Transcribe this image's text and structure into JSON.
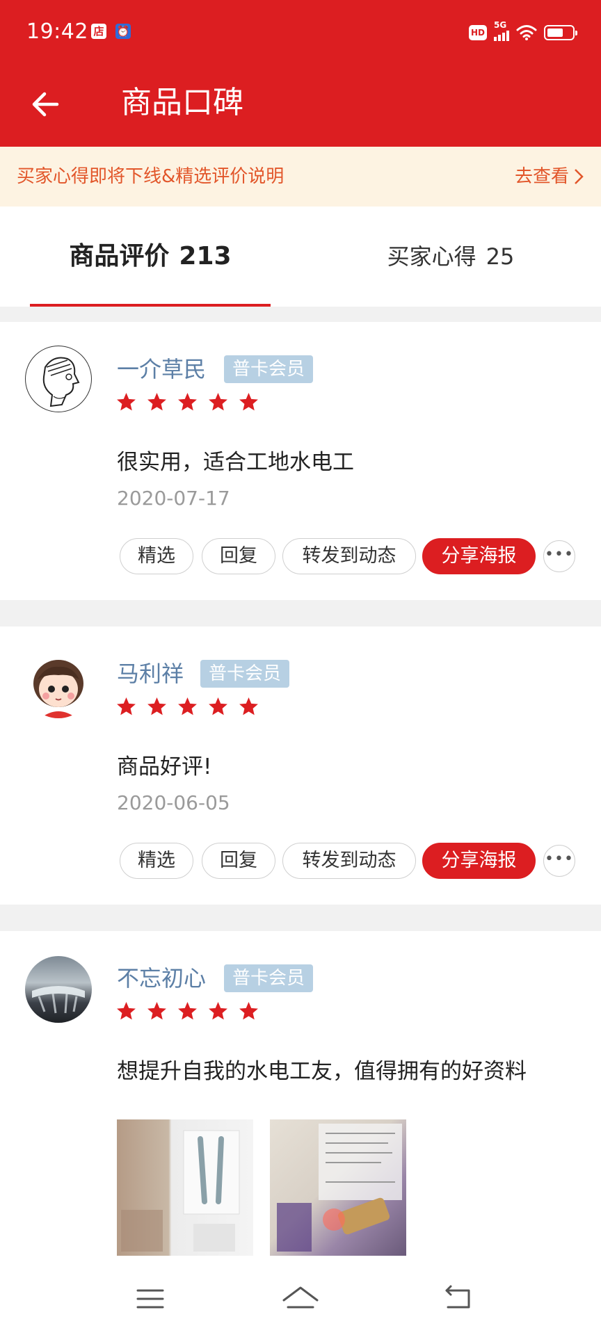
{
  "status_bar": {
    "time": "19:42",
    "store_icon_label": "店",
    "net_label": "5G",
    "hd_label": "HD",
    "battery_level": 0.6
  },
  "header": {
    "title": "商品口碑",
    "back_icon": "arrow-left-icon"
  },
  "notice": {
    "text": "买家心得即将下线&精选评价说明",
    "link": "去查看"
  },
  "tabs": [
    {
      "label": "商品评价",
      "count": "213",
      "active": true
    },
    {
      "label": "买家心得",
      "count": "25",
      "active": false
    }
  ],
  "reviews": [
    {
      "username": "一介草民",
      "badge": "普卡会员",
      "stars": 5,
      "content": "很实用，适合工地水电工",
      "date": "2020-07-17",
      "actions": [
        "精选",
        "回复",
        "转发到动态",
        "分享海报"
      ]
    },
    {
      "username": "马利祥",
      "badge": "普卡会员",
      "stars": 5,
      "content": "商品好评!",
      "date": "2020-06-05",
      "actions": [
        "精选",
        "回复",
        "转发到动态",
        "分享海报"
      ]
    },
    {
      "username": "不忘初心",
      "badge": "普卡会员",
      "stars": 5,
      "content": "想提升自我的水电工友，值得拥有的好资料"
    }
  ],
  "colors": {
    "brand": "#dc1e21",
    "notice_text": "#e2562a",
    "notice_bg": "#fdf3e2",
    "username": "#5c7fa6",
    "badge_bg": "#b7d0e3"
  }
}
